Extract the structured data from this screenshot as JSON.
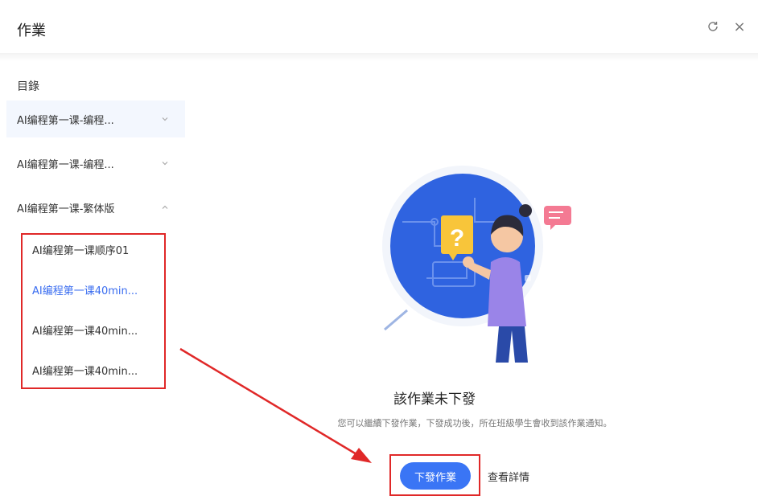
{
  "header": {
    "title": "作業"
  },
  "sidebar": {
    "toc_label": "目錄",
    "courses": [
      {
        "label": "AI编程第一课-编程...",
        "expanded": false
      },
      {
        "label": "AI编程第一课-编程...",
        "expanded": false
      },
      {
        "label": "AI编程第一课-繁体版",
        "expanded": true
      }
    ],
    "lessons": [
      {
        "label": "AI编程第一课顺序01",
        "active": false
      },
      {
        "label": "AI编程第一课40min...",
        "active": true
      },
      {
        "label": "AI编程第一课40min...",
        "active": false
      },
      {
        "label": "AI编程第一课40min...",
        "active": false
      }
    ]
  },
  "main": {
    "empty_title": "該作業未下發",
    "empty_desc": "您可以繼續下發作業，下發成功後，所在班級學生會收到該作業通知。",
    "primary_button": "下發作業",
    "secondary_button": "查看詳情"
  },
  "colors": {
    "accent": "#3a75f5",
    "highlight": "#e02828",
    "active_text": "#3a6df0"
  }
}
